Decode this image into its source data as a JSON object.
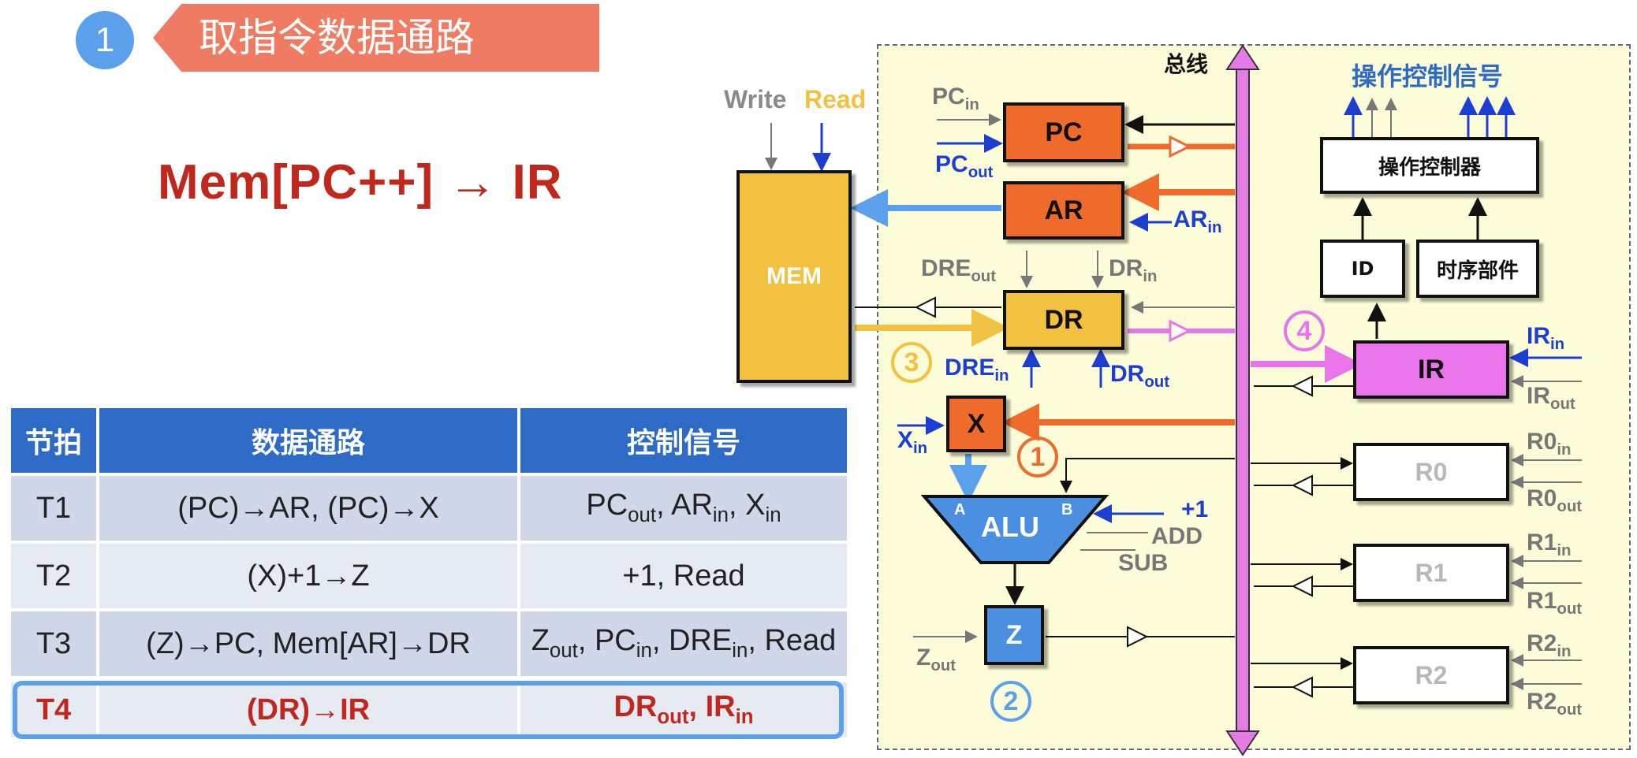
{
  "header": {
    "step_number": "1",
    "title": "取指令数据通路",
    "formula": "Mem[PC++] → IR"
  },
  "table": {
    "headers": [
      "节拍",
      "数据通路",
      "控制信号"
    ],
    "rows": [
      {
        "beat": "T1",
        "path": "(PC)→AR,  (PC)→X",
        "signals": [
          [
            "PC",
            "out"
          ],
          [
            "AR",
            "in"
          ],
          [
            "X",
            "in"
          ]
        ],
        "highlight": false
      },
      {
        "beat": "T2",
        "path": "(X)+1→Z",
        "signals": [
          [
            "+1",
            ""
          ],
          [
            "Read",
            ""
          ]
        ],
        "highlight": false
      },
      {
        "beat": "T3",
        "path": "(Z)→PC,  Mem[AR]→DR",
        "signals": [
          [
            "Z",
            "out"
          ],
          [
            "PC",
            "in"
          ],
          [
            "DRE",
            "in"
          ],
          [
            "Read",
            ""
          ]
        ],
        "highlight": false
      },
      {
        "beat": "T4",
        "path": "(DR)→IR",
        "signals": [
          [
            "DR",
            "out"
          ],
          [
            "IR",
            "in"
          ]
        ],
        "highlight": true
      }
    ]
  },
  "diagram": {
    "bus_label": "总线",
    "control_signals_label": "操作控制信号",
    "controller_label": "操作控制器",
    "id_label": "ID",
    "timing_label": "时序部件",
    "mem_label": "MEM",
    "write_label": "Write",
    "read_label": "Read",
    "registers": {
      "pc": "PC",
      "ar": "AR",
      "dr": "DR",
      "x": "X",
      "z": "Z",
      "ir": "IR",
      "r0": "R0",
      "r1": "R1",
      "r2": "R2",
      "alu": "ALU",
      "alu_a": "A",
      "alu_b": "B"
    },
    "signals": {
      "pc_in": [
        "PC",
        "in"
      ],
      "pc_out": [
        "PC",
        "out"
      ],
      "ar_in": [
        "AR",
        "in"
      ],
      "dre_out": [
        "DRE",
        "out"
      ],
      "dr_in": [
        "DR",
        "in"
      ],
      "dre_in": [
        "DRE",
        "in"
      ],
      "dr_out": [
        "DR",
        "out"
      ],
      "x_in": [
        "X",
        "in"
      ],
      "z_out": [
        "Z",
        "out"
      ],
      "ir_in": [
        "IR",
        "in"
      ],
      "ir_out": [
        "IR",
        "out"
      ],
      "r0_in": [
        "R0",
        "in"
      ],
      "r0_out": [
        "R0",
        "out"
      ],
      "r1_in": [
        "R1",
        "in"
      ],
      "r1_out": [
        "R1",
        "out"
      ],
      "r2_in": [
        "R2",
        "in"
      ],
      "r2_out": [
        "R2",
        "out"
      ]
    },
    "alu_ops": [
      "+1",
      "ADD",
      "SUB"
    ],
    "step_markers": [
      "1",
      "2",
      "3",
      "4"
    ],
    "colors": {
      "orange": "#ef6b2b",
      "yellow": "#f2c13f",
      "pink": "#ea74ea",
      "blue": "#5aa0ea",
      "dark_blue": "#1d3fd0",
      "bus": "#e57be6",
      "accent_red": "#c0281e"
    }
  }
}
